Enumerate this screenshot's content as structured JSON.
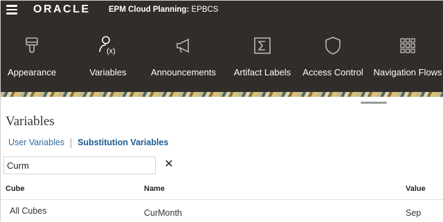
{
  "header": {
    "logo": "ORACLE",
    "app_name": "EPM Cloud Planning:",
    "app_instance": "EPBCS"
  },
  "nav": {
    "items": [
      {
        "label": "Appearance",
        "icon": "appearance-icon"
      },
      {
        "label": "Variables",
        "icon": "variables-icon"
      },
      {
        "label": "Announcements",
        "icon": "megaphone-icon"
      },
      {
        "label": "Artifact Labels",
        "icon": "sigma-icon"
      },
      {
        "label": "Access Control",
        "icon": "shield-icon"
      },
      {
        "label": "Navigation Flows",
        "icon": "grid-icon"
      }
    ]
  },
  "page": {
    "title": "Variables",
    "tabs": {
      "user": "User Variables",
      "substitution": "Substitution Variables"
    },
    "search": {
      "value": "Curm",
      "clear_icon": "close-icon"
    },
    "table": {
      "columns": [
        "Cube",
        "Name",
        "Value"
      ],
      "rows": [
        {
          "cube": "All Cubes",
          "name": "CurMonth",
          "value": "Sep"
        }
      ]
    }
  },
  "colors": {
    "header_bg": "#312d2a",
    "link": "#2d6aa3",
    "active_tab": "#1b5a96"
  }
}
